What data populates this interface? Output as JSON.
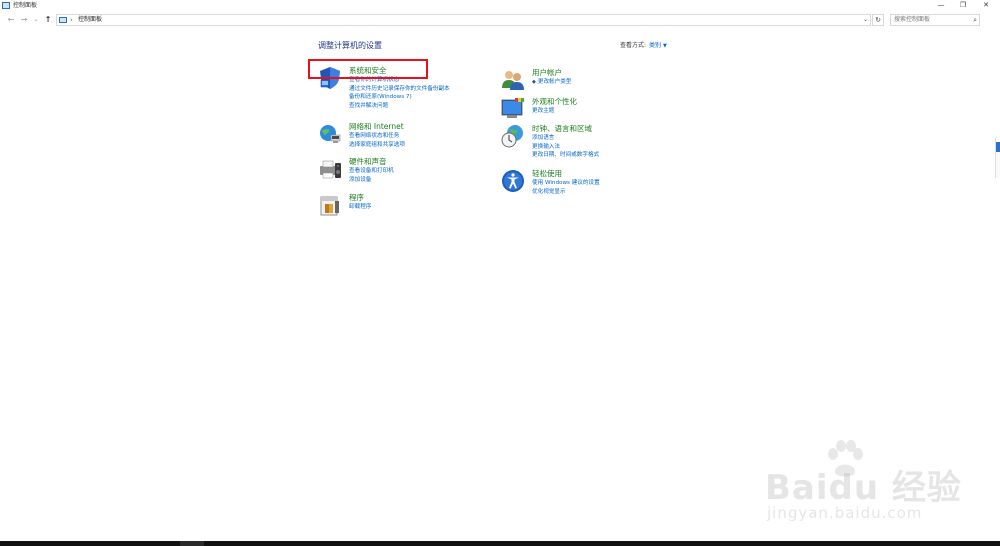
{
  "titlebar": {
    "title": "控制面板",
    "minimize": "—",
    "maximize": "❐",
    "close": "✕"
  },
  "navbar": {
    "back": "←",
    "forward": "→",
    "recent": "⌄",
    "up": "↑",
    "separator": "›",
    "breadcrumb": "控制面板",
    "dropdown": "⌄",
    "refresh": "↻",
    "search_placeholder": "搜索控制面板",
    "search_icon": "⌕"
  },
  "content": {
    "heading": "调整计算机的设置",
    "view_by_label": "查看方式:",
    "view_by_value": "类别",
    "view_by_caret": "▼"
  },
  "categories_left": [
    {
      "icon": "shield-icon",
      "title": "系统和安全",
      "links": [
        "查看你的计算机状态",
        "通过文件历史记录保存你的文件备份副本",
        "备份和还原(Windows 7)",
        "查找并解决问题"
      ]
    },
    {
      "icon": "globe-network-icon",
      "title": "网络和 Internet",
      "links": [
        "查看网络状态和任务",
        "选择家庭组和共享选项"
      ]
    },
    {
      "icon": "printer-speaker-icon",
      "title": "硬件和声音",
      "links": [
        "查看设备和打印机",
        "添加设备"
      ]
    },
    {
      "icon": "programs-icon",
      "title": "程序",
      "links": [
        "卸载程序"
      ]
    }
  ],
  "categories_right": [
    {
      "icon": "users-icon",
      "title": "用户帐户",
      "links": [
        "更改帐户类型"
      ]
    },
    {
      "icon": "display-personalize-icon",
      "title": "外观和个性化",
      "links": [
        "更改主题"
      ]
    },
    {
      "icon": "clock-globe-icon",
      "title": "时钟、语言和区域",
      "links": [
        "添加语言",
        "更换输入法",
        "更改日期、时间或数字格式"
      ]
    },
    {
      "icon": "ease-of-access-icon",
      "title": "轻松使用",
      "links": [
        "使用 Windows 建议的设置",
        "优化视觉显示"
      ]
    }
  ],
  "watermark": {
    "brand": "Bai",
    "brand_suffix": "du 经验",
    "url": "jingyan.baidu.com"
  },
  "colors": {
    "heading": "#1e3287",
    "category_title": "#1d7d1d",
    "link": "#0066cc",
    "highlight": "#e8111a"
  }
}
